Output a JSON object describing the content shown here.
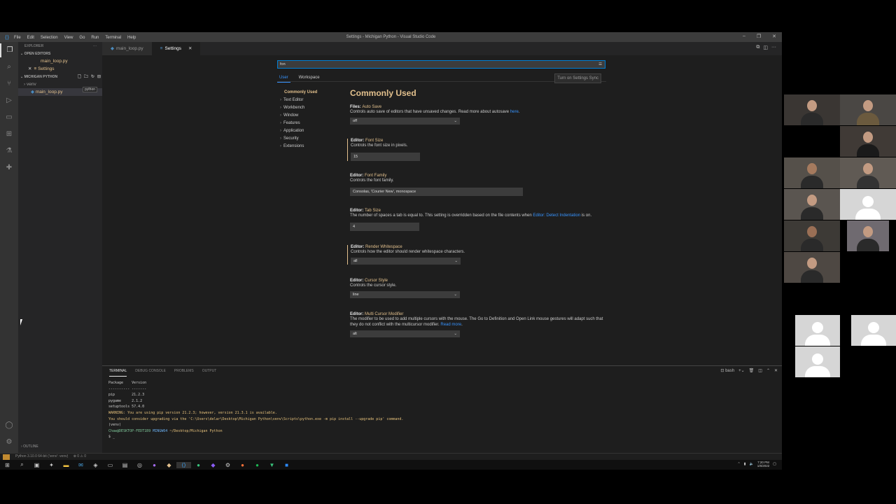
{
  "window": {
    "title": "Settings - Michigan Python - Visual Studio Code",
    "menu": [
      "File",
      "Edit",
      "Selection",
      "View",
      "Go",
      "Run",
      "Terminal",
      "Help"
    ]
  },
  "sidebar": {
    "explorer_label": "EXPLORER",
    "open_editors_label": "OPEN EDITORS",
    "open_editors": [
      "main_loop.py",
      "Settings"
    ],
    "project_label": "MICHIGAN PYTHON",
    "tree": [
      "venv",
      "main_loop.py"
    ],
    "tooltip": "python",
    "outline_label": "OUTLINE"
  },
  "tabs": [
    "main_loop.py",
    "Settings"
  ],
  "settings": {
    "search_value": "fon",
    "scope_tabs": [
      "User",
      "Workspace"
    ],
    "sync_button": "Turn on Settings Sync",
    "toc": [
      "Commonly Used",
      "Text Editor",
      "Workbench",
      "Window",
      "Features",
      "Application",
      "Security",
      "Extensions"
    ],
    "heading": "Commonly Used",
    "items": [
      {
        "category": "Files: ",
        "key": "Auto Save",
        "desc": "Controls auto save of editors that have unsaved changes. Read more about autosave ",
        "link": "here",
        "desc_end": ".",
        "value": "off"
      },
      {
        "category": "Editor: ",
        "key": "Font Size",
        "desc": "Controls the font size in pixels.",
        "value": "15"
      },
      {
        "category": "Editor: ",
        "key": "Font Family",
        "desc": "Controls the font family.",
        "value": "Consolas, 'Courier New', monospace"
      },
      {
        "category": "Editor: ",
        "key": "Tab Size",
        "desc": "The number of spaces a tab is equal to. This setting is overridden based on the file contents when ",
        "link": "Editor: Detect Indentation",
        "desc_end": " is on.",
        "value": "4"
      },
      {
        "category": "Editor: ",
        "key": "Render Whitespace",
        "desc": "Controls how the editor should render whitespace characters.",
        "value": "all"
      },
      {
        "category": "Editor: ",
        "key": "Cursor Style",
        "desc": "Controls the cursor style.",
        "value": "line"
      },
      {
        "category": "Editor: ",
        "key": "Multi Cursor Modifier",
        "desc": "The modifier to be used to add multiple cursors with the mouse. The Go to Definition and Open Link mouse gestures will adapt such that they do not conflict with the multicursor modifier. ",
        "link": "Read more",
        "desc_end": ".",
        "value": "alt"
      }
    ]
  },
  "panel": {
    "tabs": [
      "TERMINAL",
      "DEBUG CONSOLE",
      "PROBLEMS",
      "OUTPUT"
    ],
    "shell": "bash",
    "lines": {
      "l1": "Package    Version",
      "l2": "---------- -------",
      "l3": "pip        21.2.3",
      "l4": "pygame     2.1.2",
      "l5": "setuptools 57.4.0",
      "l6": "WARNING: You are using pip version 21.2.3; however, version 21.3.1 is available.",
      "l7": "You should consider upgrading via the 'C:\\Users\\delar\\Desktop\\Michigan Python\\venv\\Scripts\\python.exe -m pip install --upgrade pip' command.",
      "l8": "(venv)",
      "prompt_user": "Chaw@DESKTOP-FEDT1B9",
      "prompt_env": "MINGW64",
      "prompt_path": "~/Desktop/Michigan Python",
      "l10": "$ _"
    }
  },
  "statusbar": {
    "python": "Python 3.10.0 64-bit ('venv': venv)",
    "problems": "⊗ 0 ⚠ 0"
  },
  "taskbar": {
    "time": "7:20 PM",
    "date": "1/6/2022"
  }
}
